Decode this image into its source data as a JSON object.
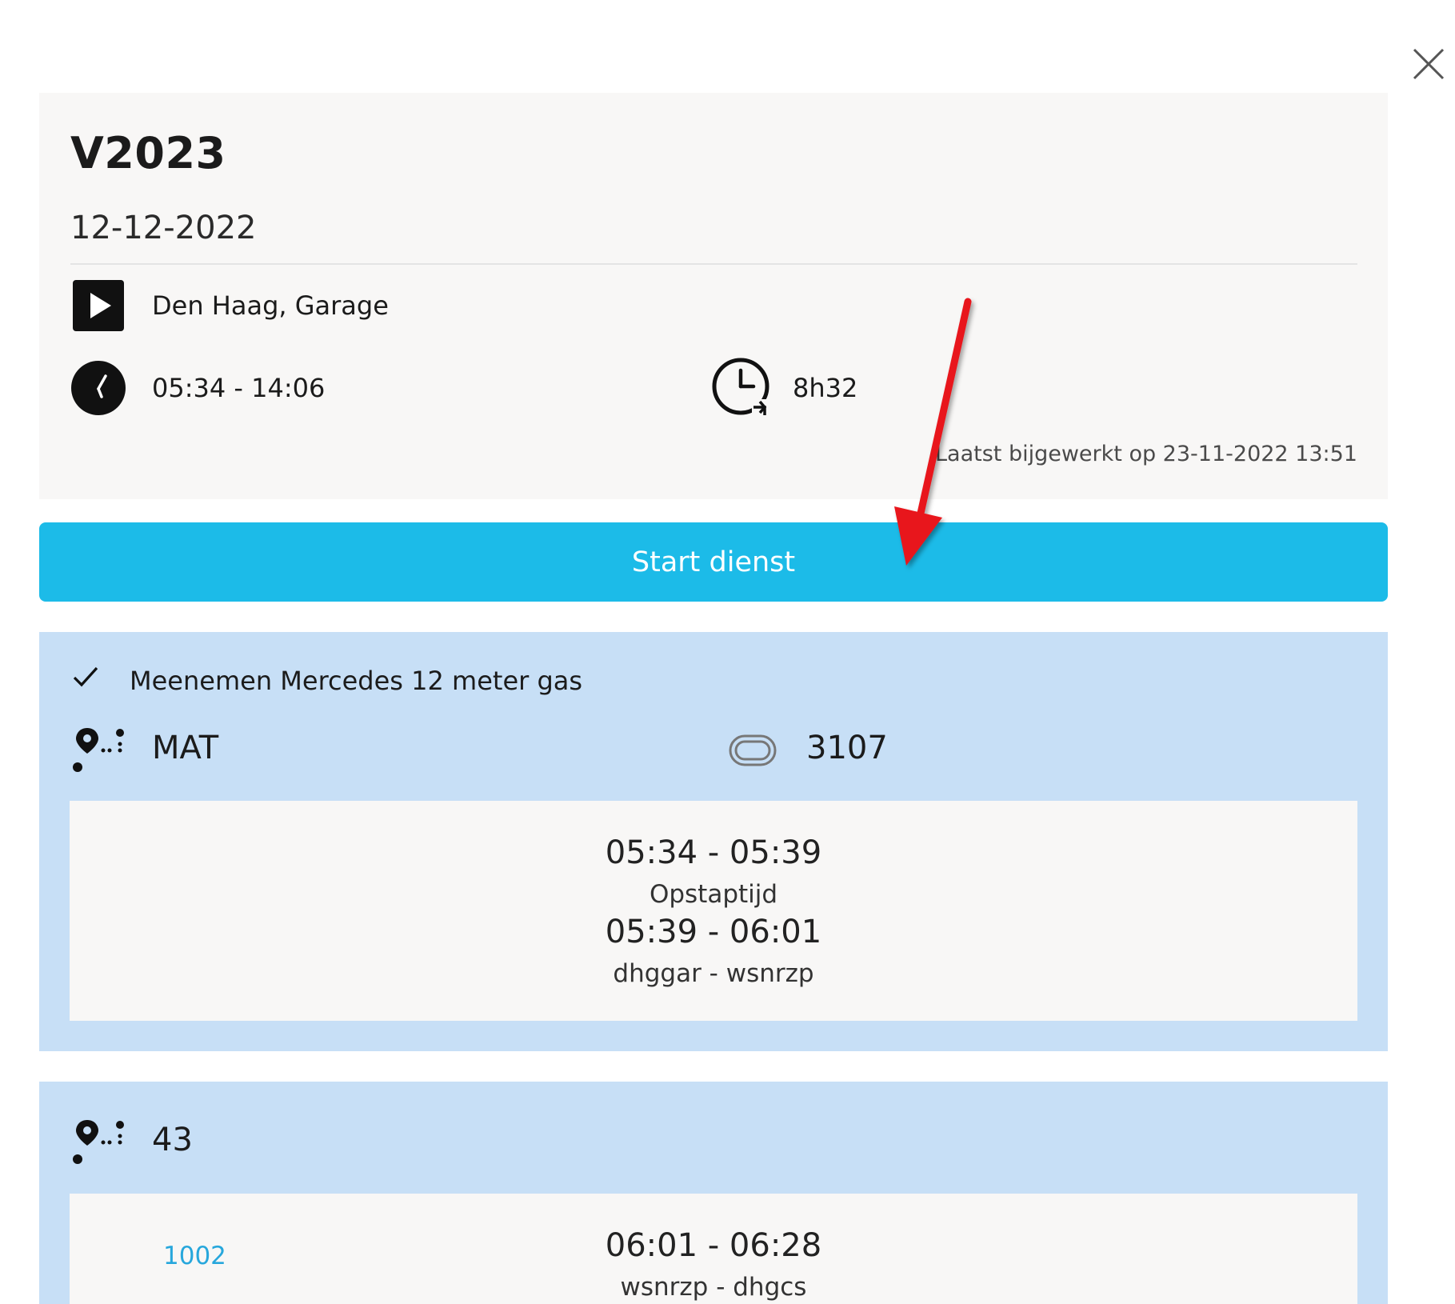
{
  "header": {
    "title": "V2023",
    "date": "12-12-2022",
    "start_location": "Den Haag, Garage",
    "time_range": "05:34 - 14:06",
    "duration": "8h32",
    "last_updated": "Laatst bijgewerkt op 23-11-2022 13:51"
  },
  "actions": {
    "start_label": "Start dienst"
  },
  "trips": [
    {
      "note": "Meenemen Mercedes 12 meter gas",
      "route": "MAT",
      "vehicle": "3107",
      "segments": [
        {
          "time": "05:34 - 05:39",
          "label": "Opstaptijd"
        },
        {
          "time": "05:39 - 06:01",
          "label": "dhggar - wsnrzp"
        }
      ]
    },
    {
      "route": "43",
      "link": "1002",
      "segments": [
        {
          "time": "06:01 - 06:28",
          "label": "wsnrzp - dhgcs"
        }
      ]
    }
  ],
  "colors": {
    "accent": "#1cbbe8",
    "trip_background": "#c7dff6",
    "card_background": "#f8f7f6",
    "annotation": "#e8141a"
  },
  "icons": [
    "close-icon",
    "play-icon",
    "clock-icon",
    "duration-icon",
    "checkmark-icon",
    "route-icon",
    "vehicle-icon",
    "annotation-arrow"
  ]
}
